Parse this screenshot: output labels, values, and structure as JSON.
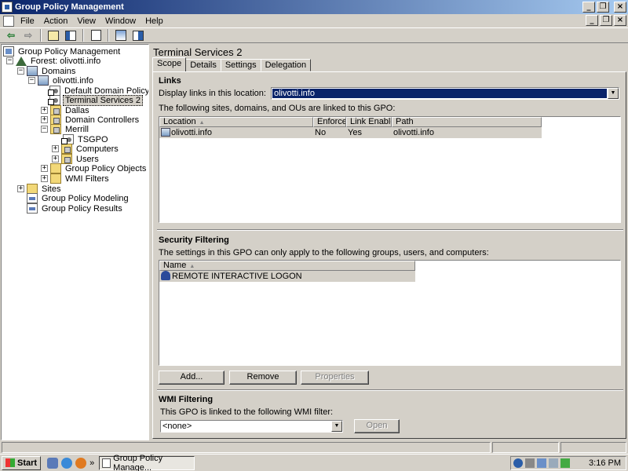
{
  "window": {
    "title": "Group Policy Management"
  },
  "menu": {
    "items": [
      "File",
      "Action",
      "View",
      "Window",
      "Help"
    ]
  },
  "tree": {
    "items": [
      {
        "label": "Group Policy Management",
        "icon": "gpm-icon",
        "expander": ""
      },
      {
        "label": "Forest: olivotti.info",
        "icon": "forest-icon",
        "expander": "−"
      },
      {
        "label": "Domains",
        "icon": "domains-icon",
        "expander": "−"
      },
      {
        "label": "olivotti.info",
        "icon": "domain-icon",
        "expander": "−"
      },
      {
        "label": "Default Domain Policy",
        "icon": "gpo-link-icon",
        "expander": ""
      },
      {
        "label": "Terminal Services 2",
        "icon": "gpo-link-icon",
        "expander": "",
        "selected": true
      },
      {
        "label": "Dallas",
        "icon": "ou-icon",
        "expander": "+"
      },
      {
        "label": "Domain Controllers",
        "icon": "ou-icon",
        "expander": "+"
      },
      {
        "label": "Merrill",
        "icon": "ou-icon",
        "expander": "−"
      },
      {
        "label": "TSGPO",
        "icon": "gpo-link-icon",
        "expander": ""
      },
      {
        "label": "Computers",
        "icon": "ou-icon",
        "expander": "+"
      },
      {
        "label": "Users",
        "icon": "ou-icon",
        "expander": "+"
      },
      {
        "label": "Group Policy Objects",
        "icon": "folder-icon",
        "expander": "+"
      },
      {
        "label": "WMI Filters",
        "icon": "folder-icon",
        "expander": "+"
      },
      {
        "label": "Sites",
        "icon": "folder-icon",
        "expander": "+"
      },
      {
        "label": "Group Policy Modeling",
        "icon": "modeling-icon",
        "expander": ""
      },
      {
        "label": "Group Policy Results",
        "icon": "results-icon",
        "expander": ""
      }
    ]
  },
  "detail": {
    "title": "Terminal Services 2",
    "tabs": [
      "Scope",
      "Details",
      "Settings",
      "Delegation"
    ],
    "links": {
      "heading": "Links",
      "display_label": "Display links in this location:",
      "location_value": "olivotti.info",
      "desc": "The following sites, domains, and OUs are linked to this GPO:",
      "columns": [
        "Location",
        "Enforced",
        "Link Enabled",
        "Path"
      ],
      "rows": [
        {
          "location": "olivotti.info",
          "enforced": "No",
          "link_enabled": "Yes",
          "path": "olivotti.info"
        }
      ]
    },
    "security": {
      "heading": "Security Filtering",
      "desc": "The settings in this GPO can only apply to the following groups, users, and computers:",
      "columns": [
        "Name"
      ],
      "rows": [
        "REMOTE INTERACTIVE LOGON"
      ],
      "buttons": {
        "add": "Add...",
        "remove": "Remove",
        "properties": "Properties"
      }
    },
    "wmi": {
      "heading": "WMI Filtering",
      "desc": "This GPO is linked to the following WMI filter:",
      "value": "<none>",
      "open": "Open"
    }
  },
  "taskbar": {
    "start": "Start",
    "task_label": "Group Policy Manage...",
    "quicklaunch_more": "»",
    "clock": "3:16 PM"
  },
  "colors": {
    "titlebar_start": "#0a246a",
    "titlebar_end": "#a6caf0",
    "selection": "#0a246a",
    "face": "#d4d0c8"
  }
}
